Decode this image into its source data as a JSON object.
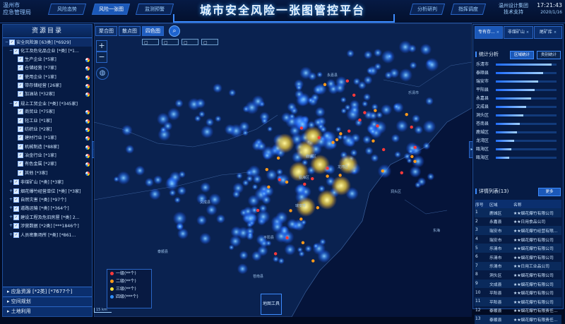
{
  "header": {
    "logo_line1": "温州市",
    "logo_line2": "应急管理局",
    "title": "城市安全风险一张图管控平台",
    "nav_left": [
      "风险态势",
      "风险一张图",
      "监测预警"
    ],
    "nav_right": [
      "分析研判",
      "指挥调度"
    ],
    "company_line1": "温州设计集团",
    "company_line2": "技术支持",
    "time": "17:21:43",
    "date": "2020/1/16"
  },
  "map": {
    "tabs": [
      "聚合图",
      "散点图",
      "四色图"
    ],
    "active_tab": "四色图",
    "search_icon": "search-icon",
    "zoom_in": "+",
    "zoom_out": "−",
    "legend": [
      {
        "label": "一级(**个)",
        "color": "#ff3a3a"
      },
      {
        "label": "二级(**个)",
        "color": "#ff9a1a"
      },
      {
        "label": "三级(**个)",
        "color": "#ffe23a"
      },
      {
        "label": "四级(***个)",
        "color": "#2f8fff"
      }
    ],
    "layer_button": "地图工具",
    "scale": "15 km",
    "places": [
      "永嘉县",
      "乐清市",
      "鹿城区",
      "龙湾区",
      "瓯海区",
      "瑞安市",
      "平阳县",
      "苍南县",
      "文成县",
      "泰顺县",
      "洞头区",
      "东海"
    ]
  },
  "left_panel": {
    "title": "资源目录",
    "items": [
      {
        "text": "安全风险源 [63类] [*6929]",
        "level": 0,
        "root": true,
        "toggle": "−"
      },
      {
        "text": "化工及危化品企业 [*类] [*1...",
        "level": 1,
        "toggle": "−"
      },
      {
        "text": "生产企业 [*5家]",
        "level": 2
      },
      {
        "text": "仓储经营 [*7家]",
        "level": 2
      },
      {
        "text": "使用企业 [*1家]",
        "level": 2
      },
      {
        "text": "带存储经营 [26家]",
        "level": 2
      },
      {
        "text": "加油站 [*32家]",
        "level": 2
      },
      {
        "text": "规上工贸企业 [*类] [*345家]",
        "level": 1,
        "toggle": "−"
      },
      {
        "text": "商贸业 [*75家]",
        "level": 2
      },
      {
        "text": "轻工业 [*1家]",
        "level": 2
      },
      {
        "text": "纺织业 [*2家]",
        "level": 2
      },
      {
        "text": "建材行业 [*1家]",
        "level": 2
      },
      {
        "text": "机械制造 [*88家]",
        "level": 2
      },
      {
        "text": "冶金行业 [*1家]",
        "level": 2
      },
      {
        "text": "有色金属 [*2家]",
        "level": 2
      },
      {
        "text": "其他 [*3家]",
        "level": 2
      },
      {
        "text": "非煤矿山 [*类] [*3家]",
        "level": 1,
        "toggle": "+"
      },
      {
        "text": "烟花爆竹经营单位 [*类] [*3家]",
        "level": 1,
        "toggle": "+"
      },
      {
        "text": "自然灾害 [*类] [*97个]",
        "level": 1,
        "toggle": "+"
      },
      {
        "text": "道路运输 [*类] [*364个]",
        "level": 1,
        "toggle": "+"
      },
      {
        "text": "建设工程及危旧房屋 [*类] 2...",
        "level": 1,
        "toggle": "+"
      },
      {
        "text": "涉营数据 [*2类] [***1846个]",
        "level": 1,
        "toggle": "+"
      },
      {
        "text": "人员密集场所 [*类] [*861...",
        "level": 1,
        "toggle": "+"
      }
    ],
    "bottom_tabs": [
      "应急资源 [*2类] [*7677个]",
      "空间规划",
      "土地利用"
    ]
  },
  "right_panel": {
    "tabs": [
      "专有存...",
      "非煤矿山",
      "尾矿库"
    ],
    "stats_title": "统计分析",
    "stats_buttons": [
      "区域统计",
      "类别统计"
    ],
    "stats": [
      {
        "name": "乐清市",
        "value": 0.92
      },
      {
        "name": "泰顺县",
        "value": 0.78
      },
      {
        "name": "瑞安市",
        "value": 0.7
      },
      {
        "name": "平阳县",
        "value": 0.64
      },
      {
        "name": "永嘉县",
        "value": 0.58
      },
      {
        "name": "文成县",
        "value": 0.5
      },
      {
        "name": "洞头区",
        "value": 0.45
      },
      {
        "name": "苍南县",
        "value": 0.4
      },
      {
        "name": "鹿城区",
        "value": 0.35
      },
      {
        "name": "龙湾区",
        "value": 0.3
      },
      {
        "name": "瓯海区",
        "value": 0.26
      },
      {
        "name": "瓯海区",
        "value": 0.22
      }
    ],
    "detail_title": "详情列表(13)",
    "detail_button": "更多",
    "columns": [
      "序号",
      "区域",
      "名称"
    ],
    "rows": [
      [
        "1",
        "鹿城区",
        "★★烟花爆竹有限公司"
      ],
      [
        "2",
        "永嘉县",
        "★★日用食品公司"
      ],
      [
        "3",
        "瑞安市",
        "★★烟花爆竹经营有限..."
      ],
      [
        "4",
        "瑞安市",
        "★★烟花爆竹有限公司"
      ],
      [
        "5",
        "乐清市",
        "★★烟花爆竹有限公司"
      ],
      [
        "6",
        "乐清市",
        "★★烟花爆竹有限公司"
      ],
      [
        "7",
        "乐清市",
        "★★日用工业品公司"
      ],
      [
        "8",
        "洞头区",
        "★★烟花爆竹有限公司"
      ],
      [
        "9",
        "文成县",
        "★★烟花爆竹有限公司"
      ],
      [
        "10",
        "平阳县",
        "★★烟花爆竹有限公司"
      ],
      [
        "11",
        "平阳县",
        "★★烟花爆竹有限公司"
      ],
      [
        "12",
        "泰顺县",
        "★★烟花爆竹有限责任..."
      ],
      [
        "13",
        "泰顺县",
        "★★烟花爆竹有限责任..."
      ]
    ]
  }
}
